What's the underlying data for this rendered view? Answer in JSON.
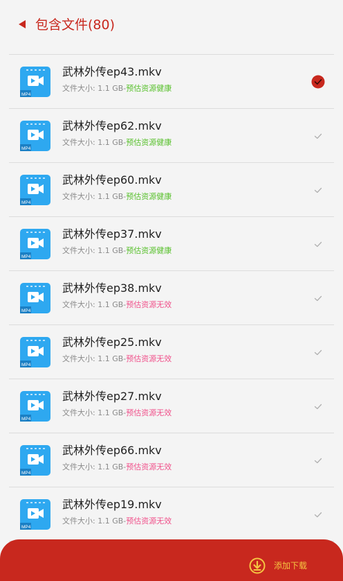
{
  "header": {
    "title": "包含文件(80)",
    "back_icon": "back-arrow-icon"
  },
  "colors": {
    "accent": "#c8281e",
    "healthy": "#58c02c",
    "invalid": "#f0508a",
    "button_text": "#f5c542"
  },
  "files": [
    {
      "name": "武林外传ep43.mkv",
      "size": "文件大小: 1.1 GB-",
      "status": "预估资源健康",
      "status_type": "ok",
      "selected": true,
      "type_label": "MP4"
    },
    {
      "name": "武林外传ep62.mkv",
      "size": "文件大小: 1.1 GB-",
      "status": "预估资源健康",
      "status_type": "ok",
      "selected": false,
      "type_label": "MP4"
    },
    {
      "name": "武林外传ep60.mkv",
      "size": "文件大小: 1.1 GB-",
      "status": "预估资源健康",
      "status_type": "ok",
      "selected": false,
      "type_label": "MP4"
    },
    {
      "name": "武林外传ep37.mkv",
      "size": "文件大小: 1.1 GB-",
      "status": "预估资源健康",
      "status_type": "ok",
      "selected": false,
      "type_label": "MP4"
    },
    {
      "name": "武林外传ep38.mkv",
      "size": "文件大小: 1.1 GB-",
      "status": "预估资源无效",
      "status_type": "bad",
      "selected": false,
      "type_label": "MP4"
    },
    {
      "name": "武林外传ep25.mkv",
      "size": "文件大小: 1.1 GB-",
      "status": "预估资源无效",
      "status_type": "bad",
      "selected": false,
      "type_label": "MP4"
    },
    {
      "name": "武林外传ep27.mkv",
      "size": "文件大小: 1.1 GB-",
      "status": "预估资源无效",
      "status_type": "bad",
      "selected": false,
      "type_label": "MP4"
    },
    {
      "name": "武林外传ep66.mkv",
      "size": "文件大小: 1.1 GB-",
      "status": "预估资源无效",
      "status_type": "bad",
      "selected": false,
      "type_label": "MP4"
    },
    {
      "name": "武林外传ep19.mkv",
      "size": "文件大小: 1.1 GB-",
      "status": "预估资源无效",
      "status_type": "bad",
      "selected": false,
      "type_label": "MP4"
    }
  ],
  "bottom_bar": {
    "add_label": "添加下载",
    "add_icon": "download-circle-icon"
  }
}
